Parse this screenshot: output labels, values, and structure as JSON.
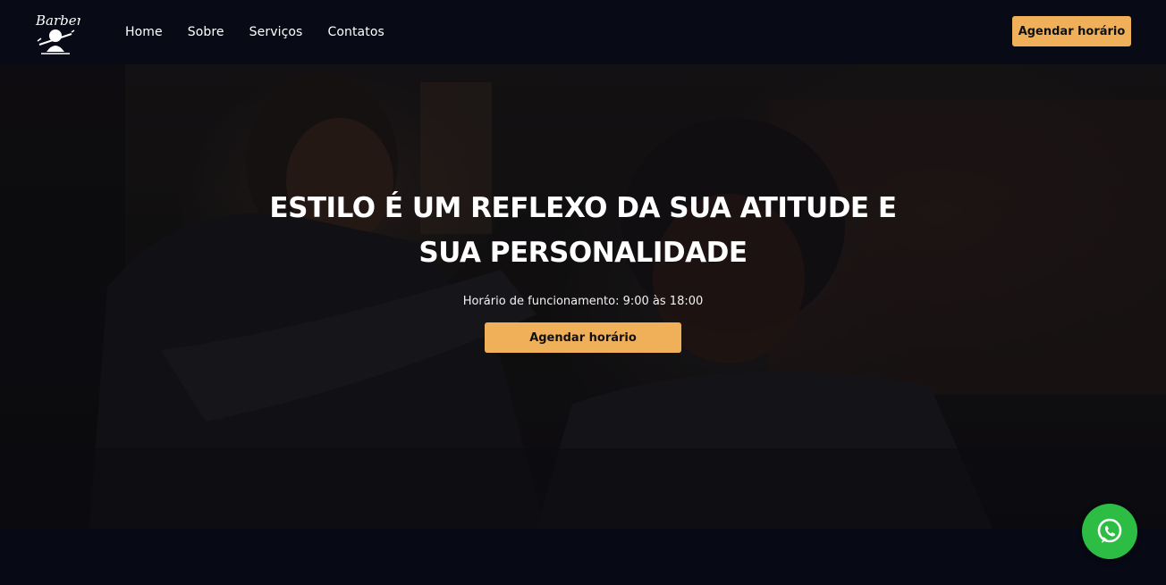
{
  "brand": {
    "logo_text": "Barber",
    "icon": "barber-logo-icon"
  },
  "nav": {
    "links": [
      "Home",
      "Sobre",
      "Serviços",
      "Contatos"
    ],
    "cta_label": "Agendar horário"
  },
  "hero": {
    "title": "ESTILO É UM REFLEXO DA SUA ATITUDE E SUA PERSONALIDADE",
    "hours": "Horário de funcionamento: 9:00 às 18:00",
    "cta_label": "Agendar horário"
  },
  "colors": {
    "accent": "#f0b05a",
    "background": "#080a16",
    "whatsapp": "#2dbd45"
  },
  "floating": {
    "icon": "whatsapp-icon"
  }
}
